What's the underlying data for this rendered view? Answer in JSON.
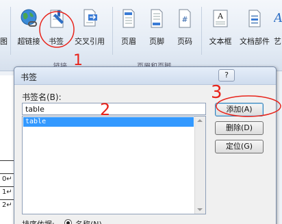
{
  "ribbon": {
    "hyperlink_label": "超链接",
    "bookmark_label": "书签",
    "crossref_label": "交叉引用",
    "header_label": "页眉",
    "footer_label": "页脚",
    "pagenum_label": "页码",
    "textbox_label": "文本框",
    "quickparts_label": "文档部件",
    "art_label": "艺",
    "left_cut_label": "图",
    "links_group_label": "链接",
    "hf_group_label": "页眉和页脚"
  },
  "document": {
    "row_numbers": [
      "0",
      "1",
      "2"
    ],
    "row_marker": "↵"
  },
  "dialog": {
    "title": "书签",
    "help_button": "?",
    "close_button": "✕",
    "name_label": "书签名(B):",
    "name_value": "table",
    "bookmarks": [
      "table"
    ],
    "add_button": "添加(A)",
    "delete_button": "删除(D)",
    "goto_button": "定位(G)",
    "sort_label": "排序依据:",
    "sort_option_name": "名称(N)"
  },
  "annotations": {
    "step1": "1",
    "step2": "2",
    "step3": "3"
  },
  "colors": {
    "annotation_red": "#e8231a",
    "selection_blue": "#3399ff"
  }
}
